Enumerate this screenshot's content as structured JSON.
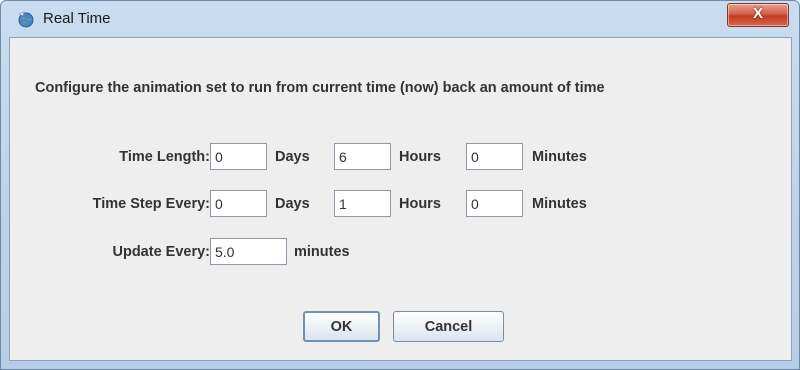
{
  "window": {
    "title": "Real Time",
    "close_label": "X"
  },
  "description": "Configure the animation set to run from current time (now) back an amount of time",
  "time_length": {
    "label": "Time Length:",
    "days_value": "0",
    "days_unit": "Days",
    "hours_value": "6",
    "hours_unit": "Hours",
    "minutes_value": "0",
    "minutes_unit": "Minutes"
  },
  "time_step": {
    "label": "Time Step Every:",
    "days_value": "0",
    "days_unit": "Days",
    "hours_value": "1",
    "hours_unit": "Hours",
    "minutes_value": "0",
    "minutes_unit": "Minutes"
  },
  "update_every": {
    "label": "Update Every:",
    "value": "5.0",
    "unit": "minutes"
  },
  "buttons": {
    "ok_label": "OK",
    "cancel_label": "Cancel"
  }
}
